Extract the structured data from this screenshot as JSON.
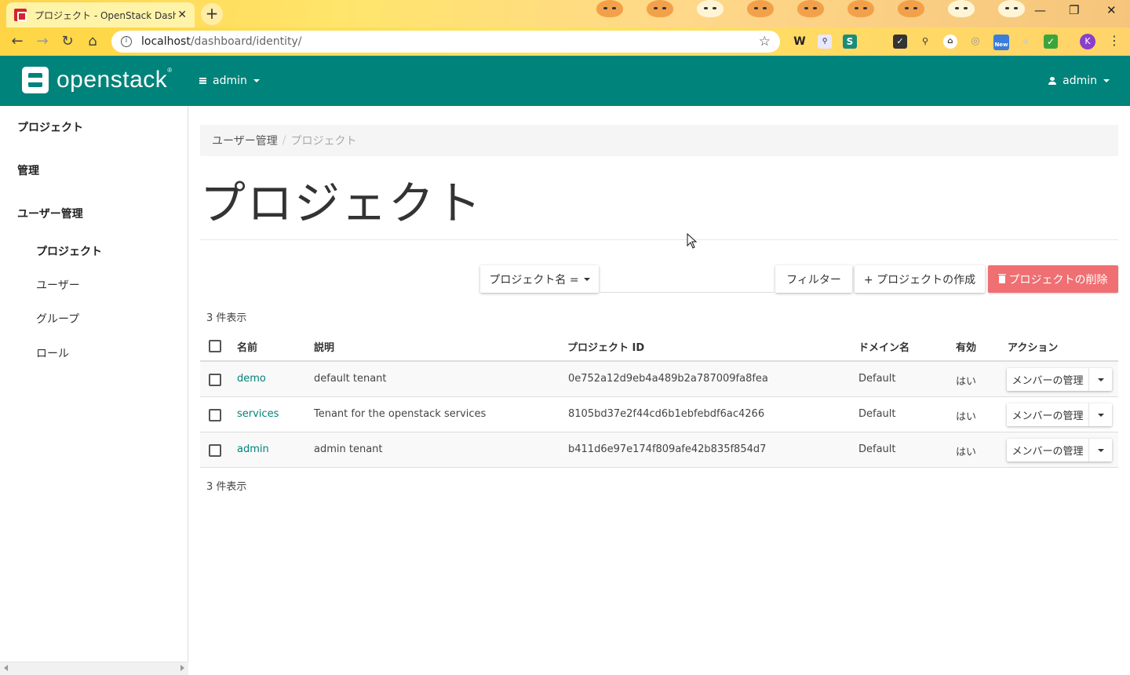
{
  "browser": {
    "tab_title": "プロジェクト - OpenStack Dashboard",
    "tab_close": "✕",
    "new_tab": "+",
    "url_host": "localhost",
    "url_path": "/dashboard/identity/",
    "profile_initial": "K",
    "ext_new_badge": "New",
    "win_minimize": "—",
    "win_restore": "❐",
    "win_close": "✕"
  },
  "header": {
    "logo_text": "openstack",
    "project_switcher": "admin",
    "user_menu": "admin"
  },
  "sidebar": {
    "items": [
      {
        "label": "プロジェクト"
      },
      {
        "label": "管理"
      },
      {
        "label": "ユーザー管理"
      }
    ],
    "subitems": [
      {
        "label": "プロジェクト",
        "active": true
      },
      {
        "label": "ユーザー"
      },
      {
        "label": "グループ"
      },
      {
        "label": "ロール"
      }
    ]
  },
  "breadcrumb": {
    "parent": "ユーザー管理",
    "separator": "/",
    "current": "プロジェクト"
  },
  "page": {
    "title": "プロジェクト"
  },
  "actions": {
    "filter_field": "プロジェクト名 =",
    "filter_value": "",
    "filter_button": "フィルター",
    "create_button": "+ プロジェクトの作成",
    "delete_button": "プロジェクトの削除"
  },
  "table": {
    "count_top": "3 件表示",
    "count_bottom": "3 件表示",
    "headers": {
      "name": "名前",
      "description": "説明",
      "project_id": "プロジェクト ID",
      "domain": "ドメイン名",
      "enabled": "有効",
      "actions": "アクション"
    },
    "rows": [
      {
        "name": "demo",
        "description": "default tenant",
        "project_id": "0e752a12d9eb4a489b2a787009fa8fea",
        "domain": "Default",
        "enabled": "はい",
        "action": "メンバーの管理"
      },
      {
        "name": "services",
        "description": "Tenant for the openstack services",
        "project_id": "8105bd37e2f44cd6b1ebfebdf6ac4266",
        "domain": "Default",
        "enabled": "はい",
        "action": "メンバーの管理"
      },
      {
        "name": "admin",
        "description": "admin tenant",
        "project_id": "b411d6e97e174f809afe42b835f854d7",
        "domain": "Default",
        "enabled": "はい",
        "action": "メンバーの管理"
      }
    ]
  },
  "colors": {
    "brand": "#00837a",
    "danger": "#ef6f72"
  }
}
